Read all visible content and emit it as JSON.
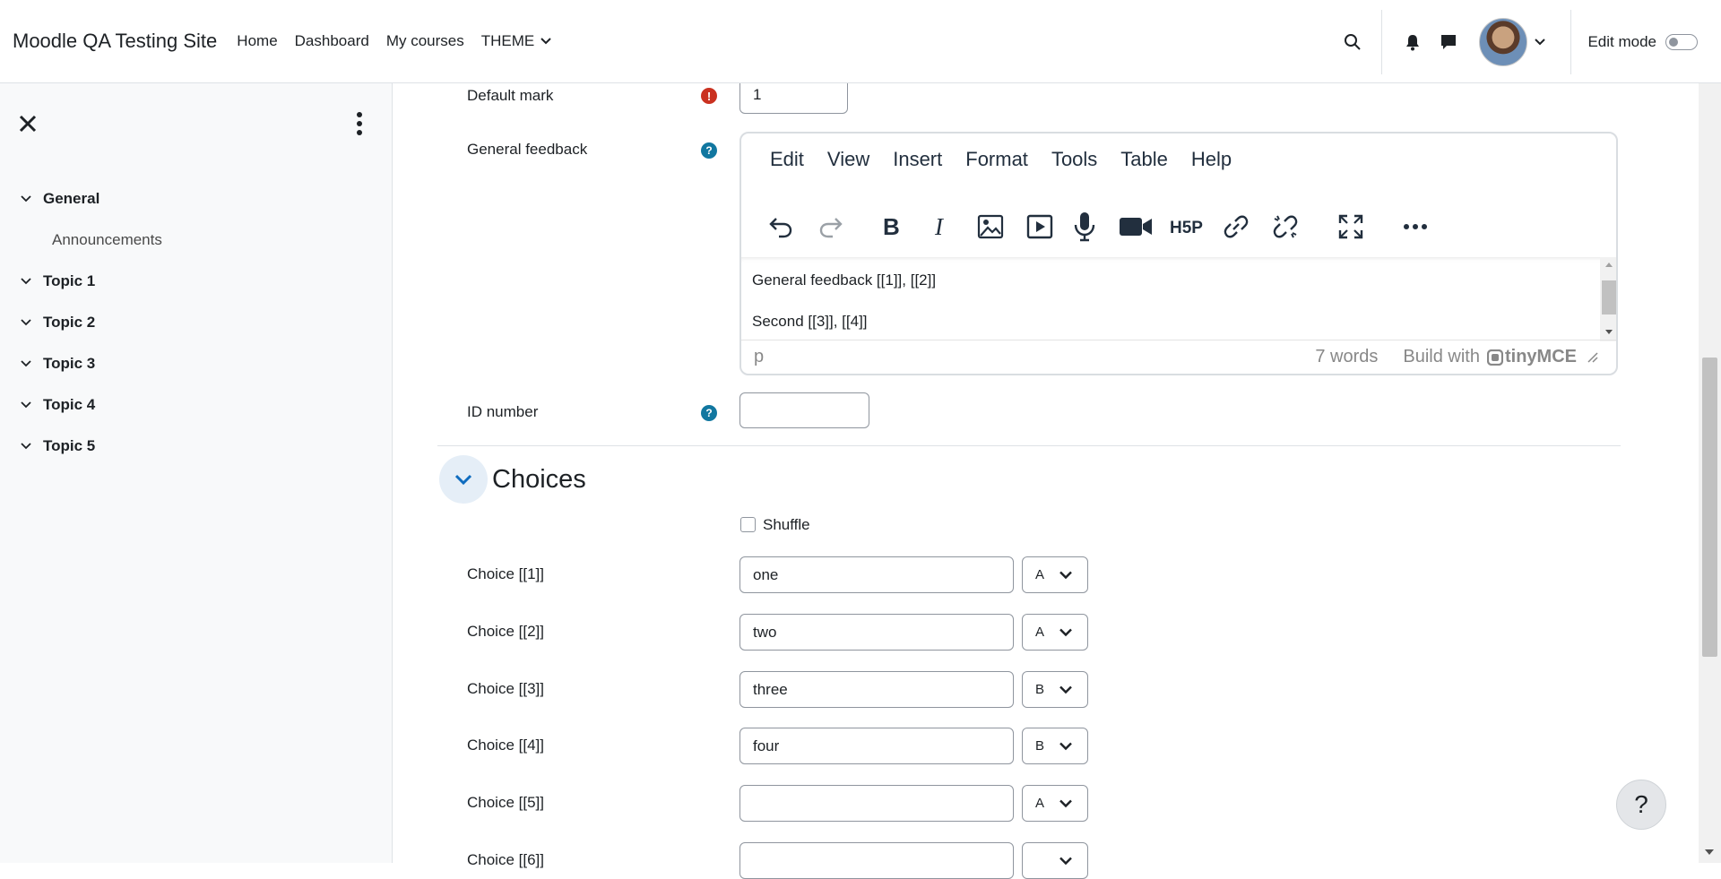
{
  "navbar": {
    "site_name": "Moodle QA Testing Site",
    "links": [
      "Home",
      "Dashboard",
      "My courses",
      "THEME"
    ],
    "edit_mode_label": "Edit mode"
  },
  "drawer": {
    "sections": [
      {
        "title": "General",
        "items": [
          "Announcements"
        ]
      },
      {
        "title": "Topic 1",
        "items": []
      },
      {
        "title": "Topic 2",
        "items": []
      },
      {
        "title": "Topic 3",
        "items": []
      },
      {
        "title": "Topic 4",
        "items": []
      },
      {
        "title": "Topic 5",
        "items": []
      }
    ]
  },
  "form": {
    "default_mark_label": "Default mark",
    "default_mark_value": "1",
    "general_feedback_label": "General feedback",
    "id_number_label": "ID number",
    "id_number_value": ""
  },
  "editor": {
    "menus": [
      "Edit",
      "View",
      "Insert",
      "Format",
      "Tools",
      "Table",
      "Help"
    ],
    "toolbar_icons": [
      "undo-icon",
      "redo-icon",
      "bold-icon",
      "italic-icon",
      "image-icon",
      "media-icon",
      "record-audio-icon",
      "record-video-icon",
      "h5p-icon",
      "link-icon",
      "unlink-icon",
      "fullscreen-icon",
      "more-icon"
    ],
    "content_line1": "General feedback [[1]], [[2]]",
    "content_line2": "Second [[3]], [[4]]",
    "status_path": "p",
    "word_count": "7 words",
    "branding_prefix": "Build with",
    "branding_name": "tinyMCE"
  },
  "choices_section": {
    "title": "Choices",
    "shuffle_label": "Shuffle",
    "shuffle_checked": false,
    "choices": [
      {
        "label": "Choice [[1]]",
        "value": "one",
        "group": "A"
      },
      {
        "label": "Choice [[2]]",
        "value": "two",
        "group": "A"
      },
      {
        "label": "Choice [[3]]",
        "value": "three",
        "group": "B"
      },
      {
        "label": "Choice [[4]]",
        "value": "four",
        "group": "B"
      },
      {
        "label": "Choice [[5]]",
        "value": "",
        "group": "A"
      },
      {
        "label": "Choice [[6]]",
        "value": "",
        "group": ""
      }
    ]
  },
  "help_button": "?",
  "colors": {
    "brand_blue": "#0f6cbf",
    "required_red": "#ca3120",
    "help_teal": "#1177a0",
    "drawer_bg": "#f8f9fa"
  }
}
